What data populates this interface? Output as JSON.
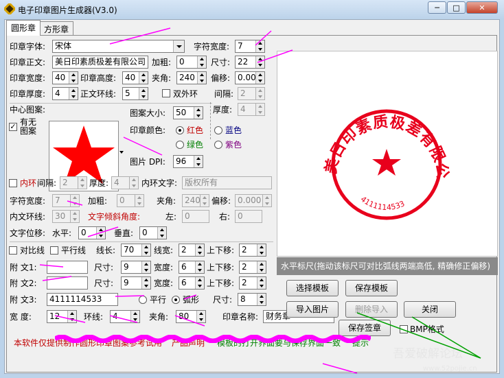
{
  "window": {
    "title": "电子印章图片生成器(V3.0)",
    "controls": {
      "minimize": "─",
      "maximize": "□",
      "close": "✕"
    }
  },
  "tabs": [
    "圆形章",
    "方形章"
  ],
  "form": {
    "font": {
      "label": "印章字体:",
      "value": "宋体"
    },
    "char_width": {
      "label": "字符宽度:",
      "value": "7"
    },
    "text": {
      "label": "印章正文:",
      "value": "美日印素质极差有限公司"
    },
    "bold": {
      "label": "加粗:",
      "value": "0"
    },
    "size": {
      "label": "尺寸:",
      "value": "22"
    },
    "width": {
      "label": "印章宽度:",
      "value": "40"
    },
    "height": {
      "label": "印章高度:",
      "value": "40"
    },
    "angle": {
      "label": "夹角:",
      "value": "240"
    },
    "offset": {
      "label": "偏移:",
      "value": "0.000"
    },
    "thickness": {
      "label": "印章厚度:",
      "value": "4"
    },
    "ring": {
      "label": "正文环线:",
      "value": "5"
    },
    "double_ring": {
      "label": "双外环",
      "checked": false
    },
    "gap": {
      "label": "间隔:",
      "value": "2"
    },
    "thickness2": {
      "label": "厚度:",
      "value": "4"
    },
    "center_image": {
      "label": "中心图案:"
    },
    "has_image": {
      "label": "有无图案",
      "checked": true
    },
    "image_size": {
      "label": "图案大小:",
      "value": "50"
    },
    "color": {
      "label": "印章颜色:",
      "options": [
        "红色",
        "蓝色",
        "绿色",
        "紫色"
      ],
      "selected": "红色"
    },
    "dpi": {
      "label": "图片 DPI:",
      "value": "96"
    },
    "inner": {
      "check_label": "内环",
      "gap": {
        "label": "间隔:",
        "value": "2"
      },
      "thickness": {
        "label": "厚度:",
        "value": "4"
      },
      "text_label": "内环文字:",
      "text_value": "版权所有",
      "char_width": {
        "label": "字符宽度:",
        "value": "7"
      },
      "bold": {
        "label": "加粗:",
        "value": "0"
      },
      "angle": {
        "label": "夹角:",
        "value": "240"
      },
      "offset": {
        "label": "偏移:",
        "value": "0.000"
      },
      "ring": {
        "label": "内文环线:",
        "value": "30"
      },
      "tilt_label": "文字倾斜角度:",
      "left": {
        "label": "左:",
        "value": "0"
      },
      "right": {
        "label": "右:",
        "value": "0"
      },
      "shift_label": "文字位移:",
      "horizontal": {
        "label": "水平:",
        "value": "0"
      },
      "vertical": {
        "label": "垂直:",
        "value": "0"
      }
    },
    "compare_line": {
      "label": "对比线"
    },
    "parallel_line": {
      "label": "平行线"
    },
    "line_length": {
      "label": "线长:",
      "value": "70"
    },
    "line_width": {
      "label": "线宽:",
      "value": "2"
    },
    "line_move": {
      "label": "上下移:",
      "value": "2"
    },
    "extra1": {
      "label": "附  文1:",
      "value": "",
      "size_label": "尺寸:",
      "size": "9",
      "width_label": "宽度:",
      "width": "6",
      "move_label": "上下移:",
      "move": "2"
    },
    "extra2": {
      "label": "附  文2:",
      "value": "",
      "size_label": "尺寸:",
      "size": "9",
      "width_label": "宽度:",
      "width": "6",
      "move_label": "上下移:",
      "move": "2"
    },
    "extra3": {
      "label": "附  文3:",
      "value": "4111114533",
      "parallel": "平行",
      "arc": "弧形",
      "size_label": "尺寸:",
      "size": "8"
    },
    "bottom_width": {
      "label": "宽    度:",
      "value": "12"
    },
    "bottom_ring": {
      "label": "环线:",
      "value": "4"
    },
    "bottom_angle": {
      "label": "夹角:",
      "value": "80"
    },
    "seal_name": {
      "label": "印章名称:",
      "value": "财务章"
    },
    "bmp": {
      "label": "BMP格式",
      "checked": false
    }
  },
  "buttons": {
    "select_template": "选择模板",
    "save_template": "保存模板",
    "import_image": "导入图片",
    "delete_import": "删除导入",
    "close": "关闭",
    "save_seal": "保存签章"
  },
  "ruler_text": "水平标尺(拖动该标尺可对比弧线两端高低, 精确修正偏移)",
  "footer": {
    "disclaimer": "本软件仅提供制作圆形印章图案参考试用",
    "statement": "产品声明",
    "tip": "模板的打开界面要与保存界面一致",
    "hint": "提示"
  },
  "seal_preview": {
    "text": "美日印素质极差有限公司",
    "number": "4111114533",
    "color": "#e8001c"
  },
  "watermark": {
    "main": "吾爱破解论坛",
    "url": "www.52pojie.cn"
  },
  "colors": {
    "accent_magenta": "#ff00ff",
    "arrow_green": "#00a000",
    "seal_red": "#e8001c",
    "star_red": "#ff0000"
  }
}
